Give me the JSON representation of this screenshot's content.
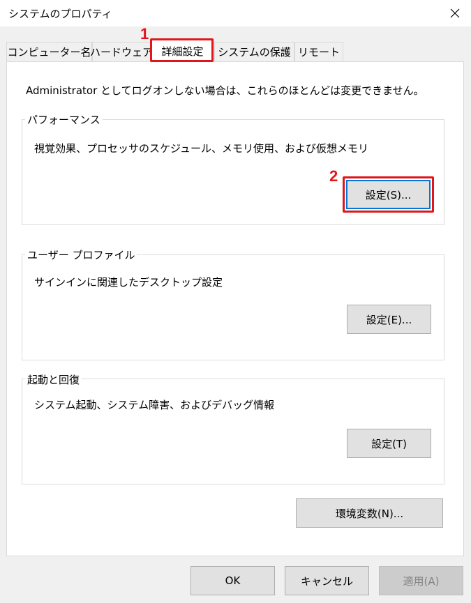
{
  "window": {
    "title": "システムのプロパティ",
    "close_icon": "close-icon"
  },
  "tabs": [
    {
      "label": "コンピューター名",
      "active": false
    },
    {
      "label": "ハードウェア",
      "active": false
    },
    {
      "label": "詳細設定",
      "active": true
    },
    {
      "label": "システムの保護",
      "active": false
    },
    {
      "label": "リモート",
      "active": false
    }
  ],
  "admin_note": "Administrator としてログオンしない場合は、これらのほとんどは変更できません。",
  "groups": {
    "performance": {
      "label": "パフォーマンス",
      "description": "視覚効果、プロセッサのスケジュール、メモリ使用、および仮想メモリ",
      "button": "設定(S)..."
    },
    "user_profile": {
      "label": "ユーザー プロファイル",
      "description": "サインインに関連したデスクトップ設定",
      "button": "設定(E)..."
    },
    "startup_recovery": {
      "label": "起動と回復",
      "description": "システム起動、システム障害、およびデバッグ情報",
      "button": "設定(T)"
    }
  },
  "env_button": "環境変数(N)...",
  "footer": {
    "ok": "OK",
    "cancel": "キャンセル",
    "apply": "適用(A)"
  },
  "annotations": {
    "step1": "1",
    "step2": "2",
    "highlight_color": "#e0161b"
  }
}
